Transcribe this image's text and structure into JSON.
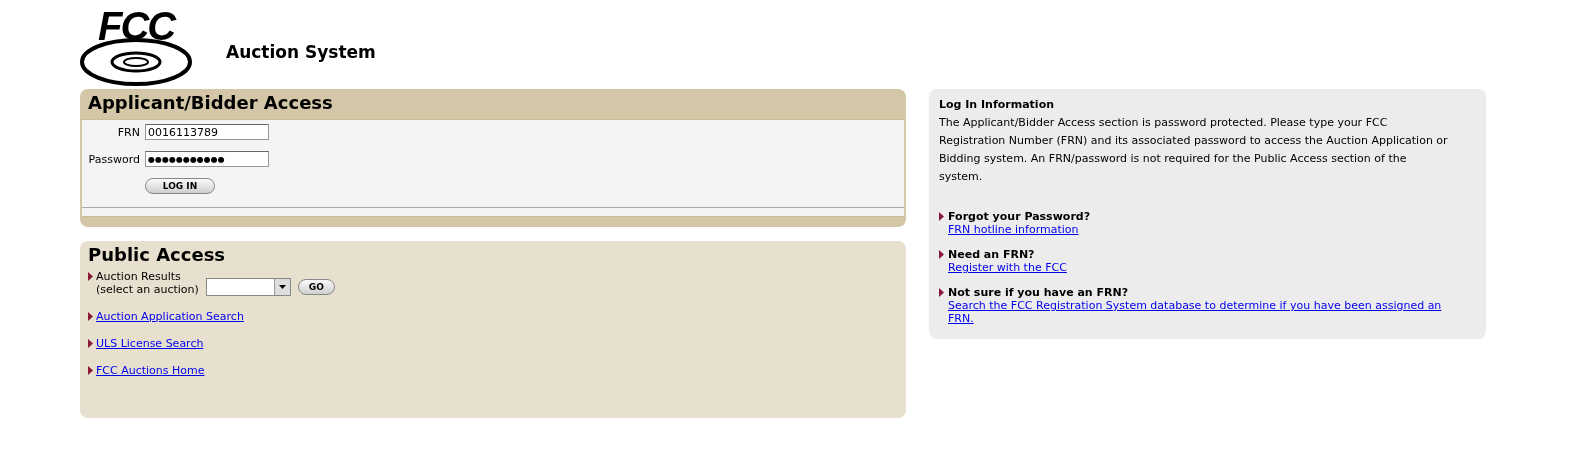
{
  "header": {
    "logo_text": "FCC",
    "title": "Auction System"
  },
  "applicant_access": {
    "title": "Applicant/Bidder Access",
    "fields": [
      {
        "label": "FRN",
        "value": "0016113789"
      },
      {
        "label": "Password",
        "value": "●●●●●●●●●●●"
      }
    ],
    "button": "LOG IN"
  },
  "public_access": {
    "title": "Public Access",
    "auction_results": {
      "label": "Auction Results",
      "sublabel": "(select an auction)",
      "button": "GO"
    },
    "links": [
      "Auction Application Search",
      "ULS License Search",
      "FCC Auctions Home"
    ]
  },
  "login_info": {
    "title": "Log In Information",
    "text": "The Applicant/Bidder Access section is password protected. Please type your FCC Registration Number (FRN) and its associated password to access the Auction Application or Bidding system. An FRN/password is not required for the Public Access section of the system.",
    "items": [
      {
        "heading": "Forgot your Password?",
        "link": "FRN hotline information"
      },
      {
        "heading": "Need an FRN?",
        "link": "Register with the FCC"
      },
      {
        "heading": "Not sure if you have an FRN?",
        "link": "Search the FCC Registration System database to determine if you have been assigned an FRN."
      }
    ]
  }
}
